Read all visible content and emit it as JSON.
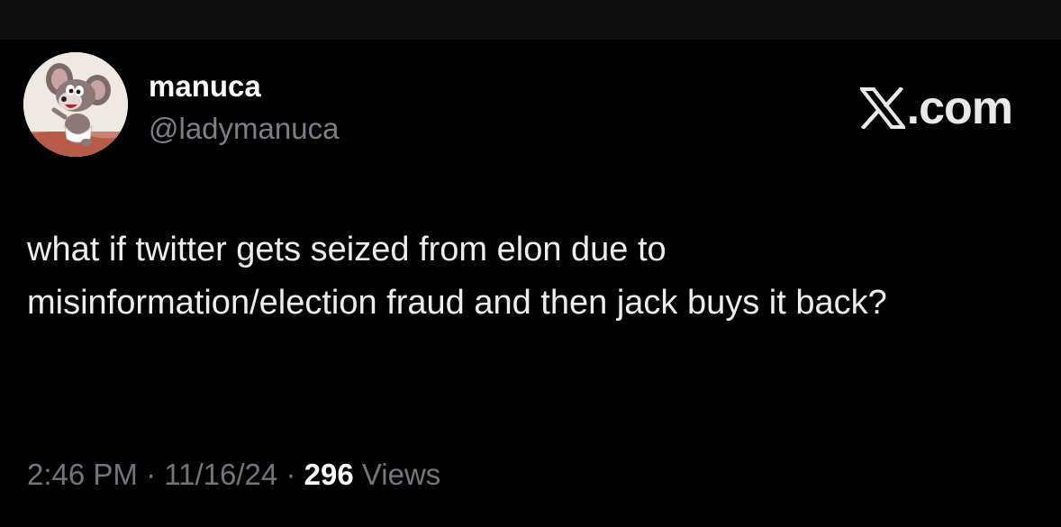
{
  "author": {
    "display_name": "manuca",
    "handle": "@ladymanuca",
    "avatar_icon": "cartoon-mouse-avatar"
  },
  "brand": {
    "icon": "x-logo-icon",
    "text": ".com"
  },
  "tweet": {
    "text": "what if twitter gets seized from elon due to misinformation/election fraud and then jack buys it back?"
  },
  "meta": {
    "time": "2:46 PM",
    "separator": "·",
    "date": "11/16/24",
    "views_count": "296",
    "views_label": "Views"
  },
  "colors": {
    "background": "#000000",
    "top_strip": "#0e0e0e",
    "primary_text": "#e7e9ea",
    "secondary_text": "#72767b"
  }
}
